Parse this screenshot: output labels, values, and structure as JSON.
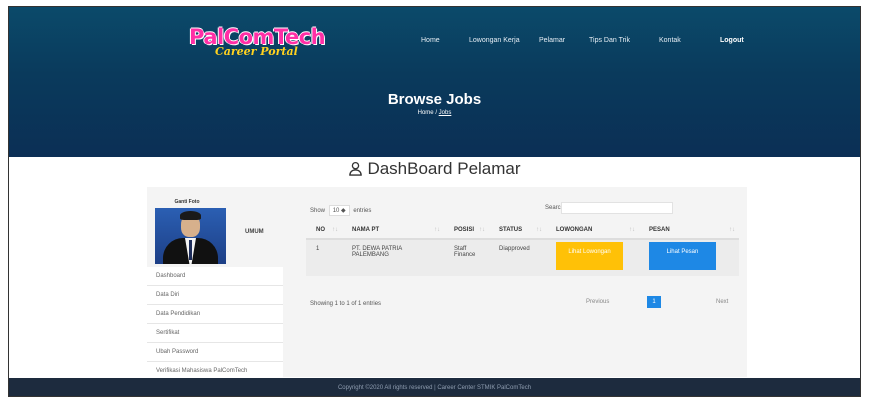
{
  "brand": {
    "name": "PalComTech",
    "tagline": "Career Portal"
  },
  "nav": [
    "Home",
    "Lowongan Kerja",
    "Pelamar",
    "Tips Dan Trik",
    "Kontak",
    "Logout"
  ],
  "hero": {
    "title": "Browse Jobs",
    "crumb_home": "Home",
    "crumb_sep": "/",
    "crumb_current": "Jobs"
  },
  "dashboard": {
    "title": "DashBoard Pelamar"
  },
  "profile": {
    "change_photo": "Ganti Foto",
    "role": "UMUM"
  },
  "sidebar": [
    "Dashboard",
    "Data Diri",
    "Data Pendidikan",
    "Sertifikat",
    "Ubah Password",
    "Verifikasi Mahasiswa PalComTech"
  ],
  "table_controls": {
    "show_label": "Show",
    "entries_value": "10",
    "entries_label": "entries",
    "search_label": "Search:",
    "search_value": ""
  },
  "table": {
    "columns": [
      "NO",
      "NAMA PT",
      "POSISI",
      "STATUS",
      "LOWONGAN",
      "PESAN"
    ],
    "rows": [
      {
        "no": "1",
        "company": "PT. DEWA PATRIA PALEMBANG",
        "position": "Staff Finance",
        "status": "Diapproved",
        "lowongan_btn": "Lihat Lowongan",
        "pesan_btn": "Lihat Pesan"
      }
    ]
  },
  "pagination": {
    "info": "Showing 1 to 1 of 1 entries",
    "prev": "Previous",
    "current": "1",
    "next": "Next"
  },
  "footer": {
    "text": "Copyright ©2020 All rights reserved | Career Center STMIK PalComTech"
  },
  "colors": {
    "hero": "#0b3a5c",
    "brand_pink": "#ff2fa6",
    "brand_yellow": "#ffd21f",
    "btn_yellow": "#ffc107",
    "btn_blue": "#1e88e5",
    "footer": "#1d2b3e"
  }
}
